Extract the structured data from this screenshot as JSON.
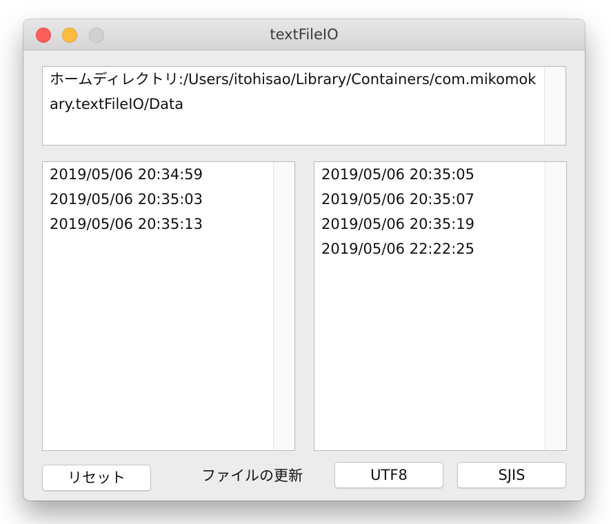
{
  "window": {
    "title": "textFileIO"
  },
  "home_directory_text": "ホームディレクトリ:/Users/itohisao/Library/Containers/com.mikomokary.textFileIO/Data",
  "left_list": {
    "items": [
      "2019/05/06 20:34:59",
      "2019/05/06 20:35:03",
      "2019/05/06 20:35:13"
    ]
  },
  "right_list": {
    "items": [
      "2019/05/06 20:35:05",
      "2019/05/06 20:35:07",
      "2019/05/06 20:35:19",
      "2019/05/06 22:22:25"
    ]
  },
  "buttons": {
    "reset": "リセット",
    "utf8": "UTF8",
    "sjis": "SJIS"
  },
  "update_label": "ファイルの更新",
  "colors": {
    "close": "#fc605c",
    "minimize": "#fdbc40",
    "zoom_disabled": "#d2d1d2",
    "window_bg": "#ececec"
  }
}
